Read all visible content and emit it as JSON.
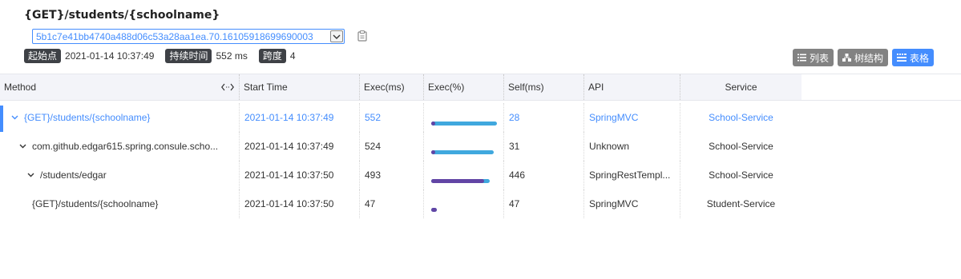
{
  "trace": {
    "title": "{GET}/students/{schoolname}",
    "trace_id": "5b1c7e41bb4740a488d06c53a28aa1ea.70.16105918699690003",
    "start_label": "起始点",
    "start_value": "2021-01-14 10:37:49",
    "duration_label": "持续时间",
    "duration_value": "552 ms",
    "span_label": "跨度",
    "span_value": "4"
  },
  "views": {
    "list": "列表",
    "tree": "树结构",
    "table": "表格",
    "active": "table"
  },
  "columns": {
    "method": "Method",
    "start_time": "Start Time",
    "exec_ms": "Exec(ms)",
    "exec_pct": "Exec(%)",
    "self_ms": "Self(ms)",
    "api": "API",
    "service": "Service"
  },
  "rows": [
    {
      "method": "{GET}/students/{schoolname}",
      "start": "2021-01-14 10:37:49",
      "exec": "552",
      "self": "28",
      "api": "SpringMVC",
      "service": "School-Service",
      "exec_fraction": 1.0,
      "self_fraction": 0.05,
      "indent": 0,
      "expandable": true
    },
    {
      "method": "com.github.edgar615.spring.consule.scho...",
      "start": "2021-01-14 10:37:49",
      "exec": "524",
      "self": "31",
      "api": "Unknown",
      "service": "School-Service",
      "exec_fraction": 0.95,
      "self_fraction": 0.06,
      "indent": 1,
      "expandable": true
    },
    {
      "method": "/students/edgar",
      "start": "2021-01-14 10:37:50",
      "exec": "493",
      "self": "446",
      "api": "SpringRestTempl...",
      "service": "School-Service",
      "exec_fraction": 0.89,
      "self_fraction": 0.81,
      "indent": 2,
      "expandable": true
    },
    {
      "method": "{GET}/students/{schoolname}",
      "start": "2021-01-14 10:37:50",
      "exec": "47",
      "self": "47",
      "api": "SpringMVC",
      "service": "Student-Service",
      "exec_fraction": 0.085,
      "self_fraction": 0.085,
      "indent": 3,
      "expandable": false
    }
  ],
  "colors": {
    "accent": "#448dfe",
    "bar_total": "#40a8de",
    "bar_self": "#6245a5",
    "tag_bg": "#3e4146",
    "header_bg": "#f3f4f9"
  }
}
